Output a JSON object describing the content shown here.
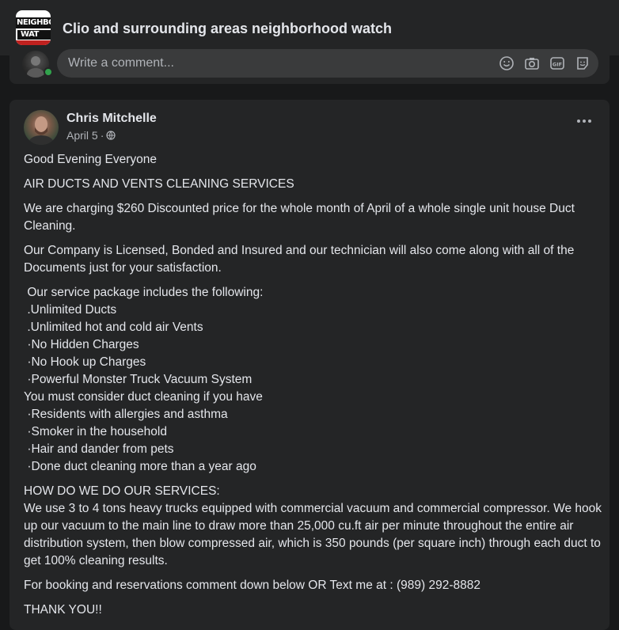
{
  "group": {
    "logo_line1": "NEIGHBO",
    "logo_line2": "WAT",
    "title": "Clio and surrounding areas neighborhood watch"
  },
  "comment_box": {
    "placeholder": "Write a comment...",
    "icons": [
      "emoji-icon",
      "camera-icon",
      "gif-icon",
      "sticker-icon"
    ]
  },
  "post": {
    "author": "Chris Mitchelle",
    "date": "April 5",
    "meta_separator": "·",
    "privacy_icon": "globe-icon",
    "paragraphs": [
      "Good Evening Everyone",
      "AIR DUCTS AND VENTS CLEANING SERVICES",
      "We are charging $260 Discounted price for the whole month of April of a whole single unit house Duct Cleaning.",
      "Our Company is Licensed, Bonded and Insured and our technician will also come along with all of the Documents just for your satisfaction.",
      " Our service package includes the following:\n .Unlimited Ducts\n .Unlimited hot and cold air Vents\n ·No Hidden Charges\n ·No Hook up Charges\n ·Powerful Monster Truck Vacuum System\nYou must consider duct cleaning if you have\n ·Residents with allergies and asthma\n ·Smoker in the household\n ·Hair and dander from pets\n ·Done duct cleaning more than a year ago",
      "HOW DO WE DO OUR SERVICES:\nWe use 3 to 4 tons heavy trucks equipped with commercial vacuum and commercial compressor. We hook up our vacuum to the main line to draw more than 25,000 cu.ft air per minute throughout the entire air distribution system, then blow compressed air, which is 350 pounds (per square inch) through each duct to get 100% cleaning results.",
      "For booking and reservations comment down below OR Text me at : (989) 292-8882",
      "THANK YOU!!"
    ]
  },
  "colors": {
    "background": "#18191a",
    "card": "#242526",
    "input": "#3a3b3c",
    "primary_text": "#e4e6eb",
    "secondary_text": "#b0b3b8",
    "online": "#31a24c",
    "logo_red": "#c0211f"
  }
}
